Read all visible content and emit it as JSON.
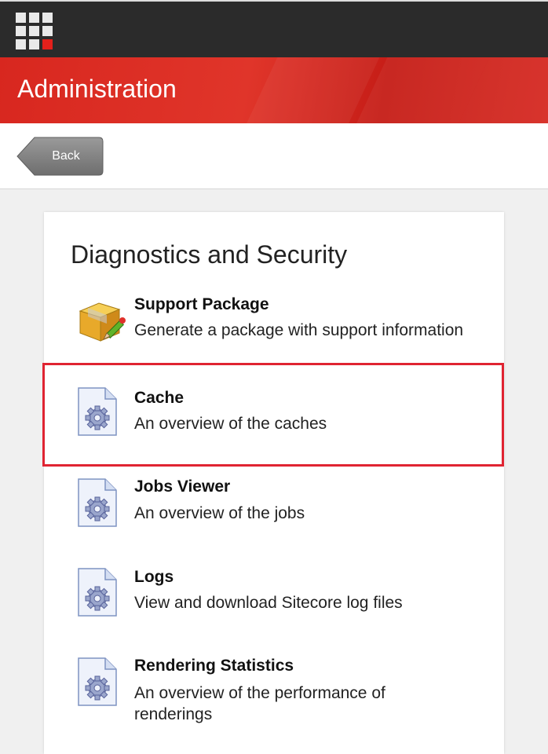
{
  "header": {
    "title": "Administration"
  },
  "toolbar": {
    "back_label": "Back"
  },
  "panel": {
    "title": "Diagnostics and Security",
    "items": [
      {
        "title": "Support Package",
        "desc": "Generate a package with support information",
        "icon": "package-icon"
      },
      {
        "title": "Cache",
        "desc": "An overview of the caches",
        "icon": "gear-document-icon"
      },
      {
        "title": "Jobs Viewer",
        "desc": "An overview of the jobs",
        "icon": "gear-document-icon"
      },
      {
        "title": "Logs",
        "desc": "View and download Sitecore log files",
        "icon": "gear-document-icon"
      },
      {
        "title": "Rendering Statistics",
        "desc": "An overview of the performance of renderings",
        "icon": "gear-document-icon"
      }
    ]
  },
  "colors": {
    "accent": "#d8271f",
    "highlight": "#e02432",
    "topbar": "#2b2b2b"
  }
}
